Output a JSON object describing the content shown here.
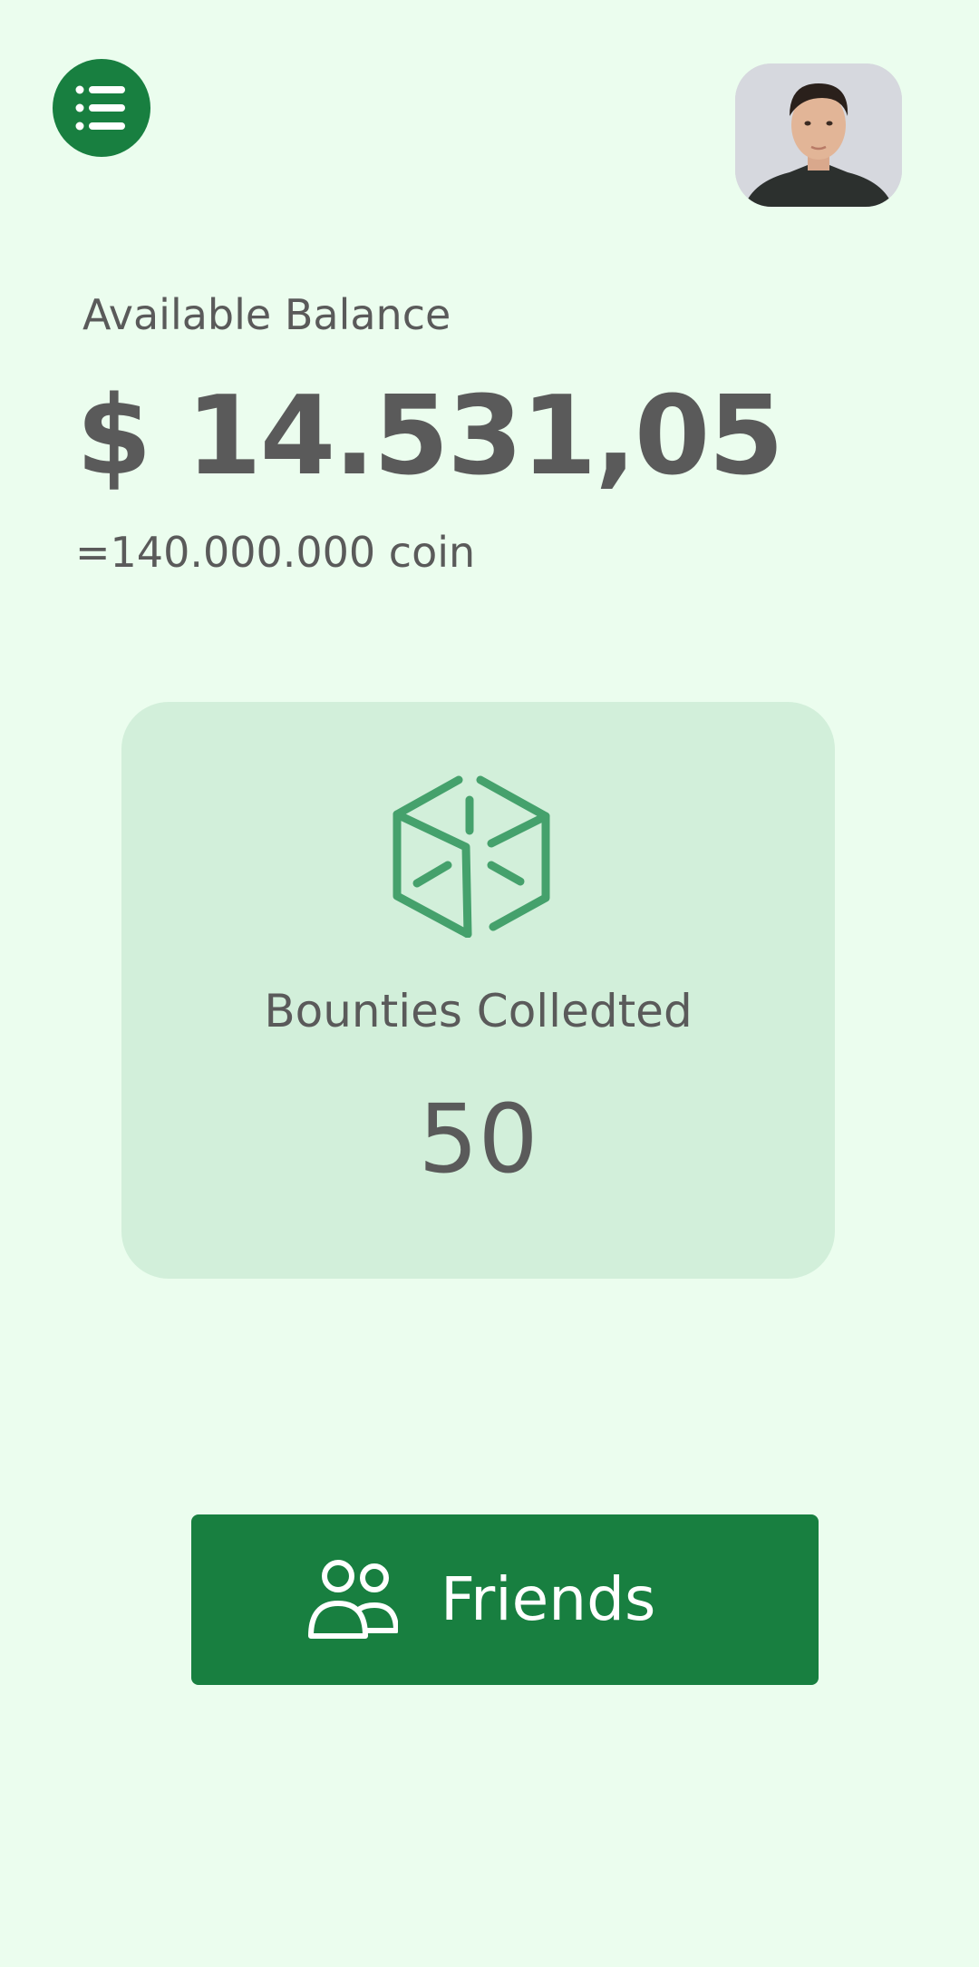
{
  "header": {
    "menu_icon": "list-icon",
    "avatar_icon": "user-photo"
  },
  "balance": {
    "label": "Available Balance",
    "amount": "$ 14.531,05",
    "coin_equivalent": "=140.000.000 coin"
  },
  "bounties": {
    "icon": "box-icon",
    "label": "Bounties Colledted",
    "value": "50"
  },
  "friends_button": {
    "icon": "users-icon",
    "label": "Friends"
  },
  "colors": {
    "background": "#ebfdee",
    "accent": "#187f40",
    "card": "#d2efda",
    "icon": "#45a16c",
    "text": "#5a5a5a"
  }
}
